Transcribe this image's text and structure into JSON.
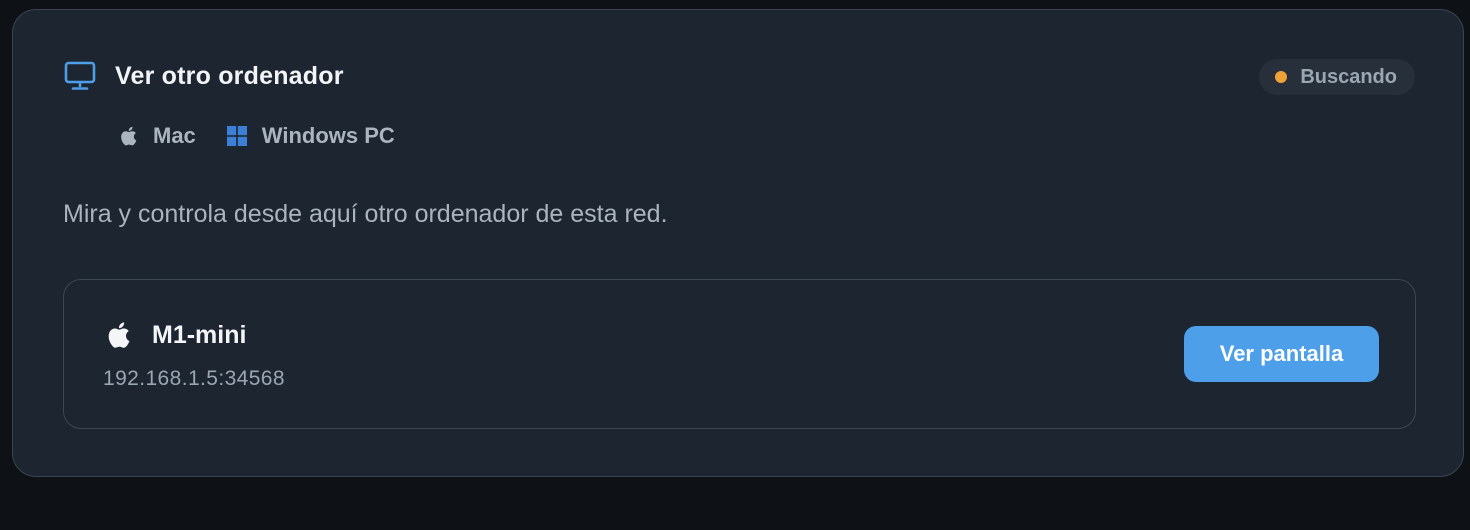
{
  "panel": {
    "title": "Ver otro ordenador",
    "title_icon": "monitor-icon",
    "status": {
      "label": "Buscando",
      "dot_color": "#f0a23a"
    },
    "platforms": [
      {
        "label": "Mac",
        "icon": "apple-icon"
      },
      {
        "label": "Windows PC",
        "icon": "windows-icon"
      }
    ],
    "description": "Mira y controla desde aquí otro ordenador de esta red."
  },
  "device": {
    "name": "M1-mini",
    "icon": "apple-icon",
    "address": "192.168.1.5:34568",
    "action_label": "Ver pantalla"
  },
  "colors": {
    "accent": "#4c9fe8",
    "card_background": "#1c2530",
    "page_background": "#0e1217",
    "windows_blue": "#3b7fd6"
  }
}
